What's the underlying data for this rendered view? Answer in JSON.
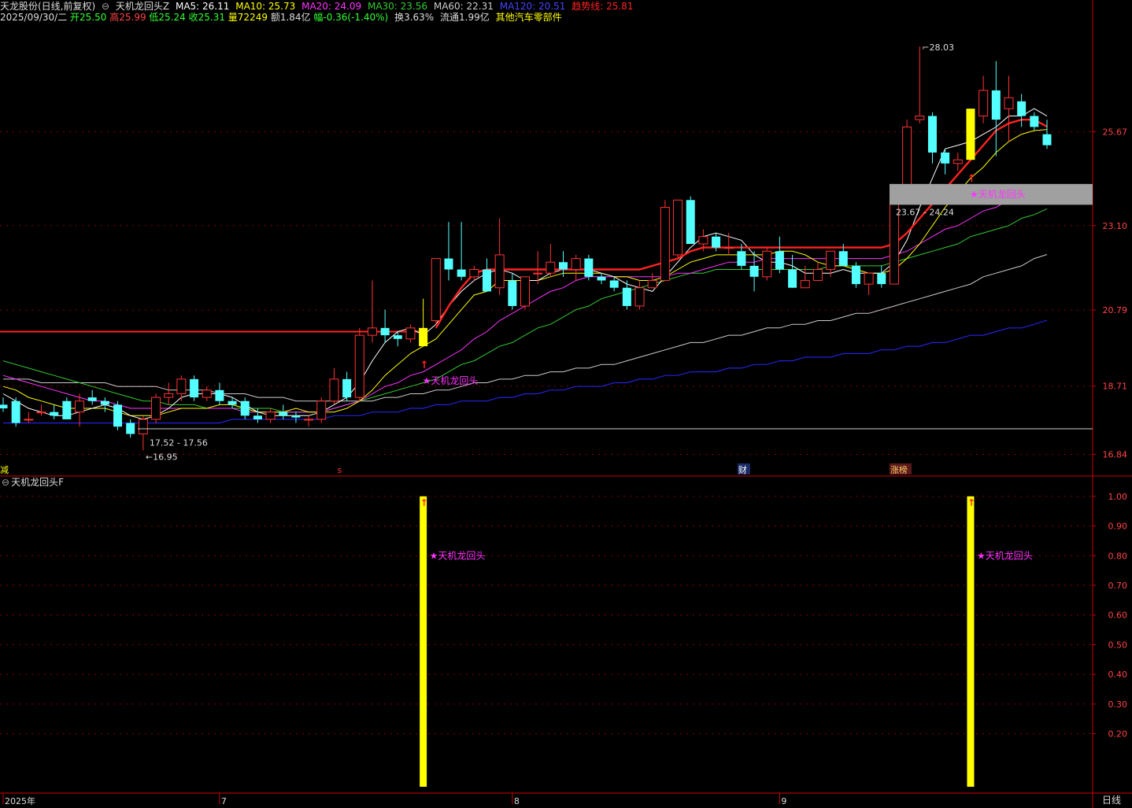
{
  "header": {
    "stock": "天龙股份(日线,前复权)",
    "indicator_name": "天机龙回头Z",
    "ma5": {
      "label": "MA5: 26.11",
      "color": "#ffffff"
    },
    "ma10": {
      "label": "MA10: 25.73",
      "color": "#ffff00"
    },
    "ma20": {
      "label": "MA20: 24.09",
      "color": "#ff33ff"
    },
    "ma30": {
      "label": "MA30: 23.56",
      "color": "#33cc33"
    },
    "ma60": {
      "label": "MA60: 22.31",
      "color": "#cccccc"
    },
    "ma120": {
      "label": "MA120: 20.51",
      "color": "#3333ff"
    },
    "trend": {
      "label": "趋势线: 25.81",
      "color": "#ff2222"
    }
  },
  "quote": {
    "date": "2025/09/30/二",
    "open": "开25.50",
    "high": "高25.99",
    "low": "低25.24",
    "close": "收25.31",
    "volume": "量72249",
    "amount": "额1.84亿",
    "change": "幅-0.36(-1.40%)",
    "turnover": "换3.63%",
    "float": "流通1.99亿",
    "sector": "其他汽车零部件"
  },
  "sub_panel_title": "天机龙回头F",
  "period_tab": "日线",
  "colors": {
    "up": "#ff3333",
    "down": "#54ffff",
    "signal": "#ffff00",
    "grid": "#8b0000"
  },
  "chart_data": [
    {
      "type": "candlestick",
      "ylim": [
        16.4,
        28.8
      ],
      "y_ticks": [
        "25.67",
        "23.10",
        "20.79",
        "18.71",
        "16.84"
      ],
      "y_tick_values": [
        25.67,
        23.1,
        20.79,
        18.71,
        16.84
      ],
      "x_labels": [
        "2025年",
        "7",
        "8",
        "9"
      ],
      "x_label_index": [
        0,
        17,
        40,
        61
      ],
      "annotations": {
        "high_label": "28.03",
        "low_label": "16.95",
        "range_low": "17.52 - 17.56",
        "range_high": "23.67 - 24.24",
        "signal_text": "★天机龙回头",
        "event_s": "s",
        "event_cai": "财",
        "event_zhangbang": "涨榜",
        "event_left": "减"
      },
      "ohlc": [
        [
          18.2,
          18.4,
          18.0,
          18.1
        ],
        [
          18.3,
          18.4,
          17.6,
          17.7
        ],
        [
          17.8,
          18.0,
          17.7,
          17.8
        ],
        [
          18.0,
          18.2,
          17.9,
          18.0
        ],
        [
          18.0,
          18.2,
          17.8,
          17.9
        ],
        [
          18.3,
          18.4,
          17.8,
          17.8
        ],
        [
          18.0,
          18.5,
          17.6,
          18.3
        ],
        [
          18.4,
          18.6,
          18.2,
          18.3
        ],
        [
          18.3,
          18.4,
          18.0,
          18.2
        ],
        [
          18.2,
          18.3,
          17.5,
          17.6
        ],
        [
          17.7,
          17.8,
          17.3,
          17.4
        ],
        [
          17.4,
          17.9,
          16.95,
          17.8
        ],
        [
          17.8,
          18.5,
          17.7,
          18.4
        ],
        [
          18.4,
          18.8,
          18.2,
          18.5
        ],
        [
          18.5,
          19.0,
          18.3,
          18.9
        ],
        [
          18.9,
          19.0,
          18.3,
          18.4
        ],
        [
          18.4,
          18.7,
          18.3,
          18.6
        ],
        [
          18.6,
          18.8,
          18.2,
          18.3
        ],
        [
          18.3,
          18.4,
          18.1,
          18.2
        ],
        [
          18.3,
          18.4,
          17.8,
          17.9
        ],
        [
          17.9,
          18.1,
          17.7,
          17.8
        ],
        [
          17.8,
          18.1,
          17.7,
          18.0
        ],
        [
          18.0,
          18.2,
          17.8,
          17.9
        ],
        [
          17.9,
          18.0,
          17.7,
          17.85
        ],
        [
          17.8,
          17.9,
          17.6,
          17.8
        ],
        [
          17.8,
          18.4,
          17.7,
          18.3
        ],
        [
          18.3,
          19.2,
          18.2,
          18.9
        ],
        [
          18.9,
          19.1,
          18.3,
          18.4
        ],
        [
          18.4,
          20.3,
          18.3,
          20.1
        ],
        [
          20.1,
          21.6,
          19.9,
          20.3
        ],
        [
          20.3,
          20.8,
          19.9,
          20.1
        ],
        [
          20.1,
          20.2,
          19.8,
          20.0
        ],
        [
          20.0,
          20.4,
          19.9,
          20.3
        ],
        [
          20.3,
          21.1,
          19.8,
          19.8
        ],
        [
          20.5,
          22.2,
          20.4,
          22.2
        ],
        [
          22.2,
          23.2,
          21.6,
          21.9
        ],
        [
          21.9,
          23.2,
          21.6,
          21.7
        ],
        [
          21.7,
          22.0,
          21.6,
          21.9
        ],
        [
          21.9,
          22.2,
          21.3,
          21.3
        ],
        [
          21.4,
          23.3,
          21.2,
          22.3
        ],
        [
          21.6,
          21.8,
          20.8,
          20.9
        ],
        [
          20.9,
          21.7,
          20.8,
          21.7
        ],
        [
          21.8,
          22.4,
          21.5,
          21.8
        ],
        [
          21.8,
          22.6,
          21.7,
          22.1
        ],
        [
          22.1,
          22.4,
          21.7,
          21.9
        ],
        [
          21.9,
          22.3,
          21.6,
          22.2
        ],
        [
          22.2,
          22.3,
          21.6,
          21.7
        ],
        [
          21.7,
          21.8,
          21.5,
          21.6
        ],
        [
          21.6,
          21.7,
          21.3,
          21.4
        ],
        [
          21.4,
          21.6,
          20.8,
          20.9
        ],
        [
          20.9,
          21.6,
          20.8,
          21.4
        ],
        [
          21.4,
          21.8,
          21.4,
          21.6
        ],
        [
          21.6,
          23.8,
          21.6,
          23.6
        ],
        [
          22.3,
          23.8,
          22.2,
          23.8
        ],
        [
          23.8,
          23.9,
          22.6,
          22.6
        ],
        [
          22.6,
          23.0,
          22.4,
          22.8
        ],
        [
          22.8,
          22.9,
          22.4,
          22.5
        ],
        [
          22.5,
          22.9,
          22.3,
          22.5
        ],
        [
          22.4,
          22.6,
          21.9,
          22.0
        ],
        [
          22.0,
          22.4,
          21.3,
          21.7
        ],
        [
          21.7,
          22.5,
          21.6,
          22.4
        ],
        [
          22.4,
          22.8,
          21.8,
          21.9
        ],
        [
          21.9,
          22.3,
          21.4,
          21.4
        ],
        [
          21.4,
          22.0,
          21.5,
          21.6
        ],
        [
          21.6,
          22.1,
          21.6,
          21.9
        ],
        [
          21.9,
          22.4,
          21.7,
          22.4
        ],
        [
          22.4,
          22.6,
          22.0,
          22.0
        ],
        [
          22.0,
          22.1,
          21.4,
          21.5
        ],
        [
          21.5,
          21.8,
          21.2,
          21.8
        ],
        [
          21.8,
          22.0,
          21.4,
          21.5
        ],
        [
          21.5,
          23.8,
          21.5,
          23.8
        ],
        [
          23.8,
          26.0,
          23.7,
          25.8
        ],
        [
          26.0,
          28.0,
          25.9,
          26.1
        ],
        [
          26.1,
          26.2,
          24.8,
          25.1
        ],
        [
          25.1,
          25.2,
          24.5,
          24.8
        ],
        [
          24.8,
          25.1,
          24.6,
          24.9
        ],
        [
          24.9,
          26.3,
          24.9,
          26.3
        ],
        [
          26.1,
          27.2,
          25.9,
          26.8
        ],
        [
          26.8,
          27.6,
          25.0,
          26.0
        ],
        [
          26.3,
          27.2,
          25.4,
          26.6
        ],
        [
          26.5,
          26.7,
          25.8,
          26.1
        ],
        [
          26.1,
          26.2,
          25.7,
          25.8
        ],
        [
          25.6,
          26.0,
          25.2,
          25.3
        ]
      ],
      "ma5": [
        18.5,
        18.3,
        18.1,
        18.0,
        17.9,
        17.9,
        18.0,
        18.1,
        18.2,
        18.1,
        17.9,
        17.8,
        17.9,
        18.1,
        18.4,
        18.5,
        18.5,
        18.5,
        18.4,
        18.2,
        18.0,
        17.9,
        17.9,
        17.9,
        17.9,
        18.0,
        18.2,
        18.4,
        18.8,
        19.4,
        19.9,
        20.2,
        20.3,
        20.1,
        20.4,
        20.9,
        21.3,
        21.6,
        21.8,
        21.9,
        21.8,
        21.6,
        21.6,
        21.8,
        21.9,
        21.9,
        21.9,
        21.8,
        21.7,
        21.5,
        21.4,
        21.3,
        21.7,
        22.1,
        22.5,
        22.8,
        22.9,
        22.8,
        22.7,
        22.3,
        22.1,
        22.1,
        22.0,
        21.8,
        21.8,
        21.8,
        21.9,
        21.8,
        21.8,
        21.8,
        22.1,
        22.7,
        23.6,
        24.4,
        25.2,
        25.3,
        25.4,
        25.6,
        25.8,
        26.1,
        26.1,
        26.3,
        26.1
      ],
      "ma10": [
        18.7,
        18.6,
        18.4,
        18.3,
        18.2,
        18.1,
        18.1,
        18.1,
        18.1,
        18.0,
        17.9,
        17.9,
        17.9,
        18.0,
        18.1,
        18.1,
        18.1,
        18.2,
        18.2,
        18.1,
        18.0,
        18.0,
        18.0,
        18.1,
        18.0,
        18.0,
        18.0,
        18.1,
        18.3,
        18.6,
        19.0,
        19.3,
        19.6,
        19.8,
        20.0,
        20.4,
        20.8,
        21.2,
        21.3,
        21.6,
        21.6,
        21.6,
        21.6,
        21.7,
        21.8,
        21.8,
        21.8,
        21.8,
        21.7,
        21.7,
        21.6,
        21.6,
        21.7,
        21.9,
        22.1,
        22.2,
        22.3,
        22.3,
        22.3,
        22.3,
        22.3,
        22.4,
        22.4,
        22.3,
        22.1,
        22.0,
        22.0,
        21.9,
        21.8,
        21.8,
        21.9,
        22.2,
        22.6,
        23.1,
        23.6,
        24.0,
        24.4,
        24.7,
        25.1,
        25.4,
        25.6,
        25.7,
        25.73
      ],
      "ma20": [
        19.0,
        18.9,
        18.8,
        18.7,
        18.6,
        18.5,
        18.4,
        18.3,
        18.3,
        18.2,
        18.1,
        18.1,
        18.1,
        18.1,
        18.1,
        18.1,
        18.1,
        18.1,
        18.1,
        18.0,
        18.0,
        18.0,
        18.0,
        18.0,
        18.0,
        18.0,
        18.1,
        18.2,
        18.3,
        18.5,
        18.7,
        18.8,
        19.0,
        19.1,
        19.3,
        19.5,
        19.7,
        20.0,
        20.2,
        20.5,
        20.7,
        20.9,
        21.1,
        21.3,
        21.4,
        21.6,
        21.7,
        21.7,
        21.7,
        21.7,
        21.7,
        21.7,
        21.7,
        21.8,
        21.8,
        21.9,
        22.0,
        22.1,
        22.1,
        22.1,
        22.2,
        22.2,
        22.2,
        22.2,
        22.2,
        22.2,
        22.2,
        22.2,
        22.2,
        22.2,
        22.3,
        22.4,
        22.6,
        22.8,
        23.0,
        23.1,
        23.3,
        23.5,
        23.6,
        23.8,
        23.9,
        24.0,
        24.09
      ],
      "ma30": [
        19.4,
        19.3,
        19.2,
        19.1,
        19.0,
        18.9,
        18.8,
        18.7,
        18.6,
        18.5,
        18.4,
        18.3,
        18.3,
        18.2,
        18.2,
        18.2,
        18.1,
        18.1,
        18.1,
        18.1,
        18.1,
        18.1,
        18.0,
        18.0,
        18.0,
        18.0,
        18.1,
        18.2,
        18.3,
        18.4,
        18.5,
        18.6,
        18.7,
        18.8,
        18.9,
        19.1,
        19.3,
        19.4,
        19.6,
        19.8,
        19.9,
        20.1,
        20.3,
        20.4,
        20.6,
        20.8,
        20.9,
        21.1,
        21.2,
        21.3,
        21.4,
        21.5,
        21.6,
        21.7,
        21.8,
        21.8,
        21.9,
        21.9,
        21.9,
        21.9,
        21.9,
        21.9,
        21.9,
        21.9,
        21.9,
        22.0,
        22.0,
        22.0,
        22.0,
        22.0,
        22.1,
        22.2,
        22.3,
        22.4,
        22.5,
        22.6,
        22.8,
        22.9,
        23.0,
        23.1,
        23.3,
        23.4,
        23.56
      ],
      "ma60": [
        18.9,
        18.9,
        18.9,
        18.8,
        18.8,
        18.8,
        18.8,
        18.8,
        18.8,
        18.7,
        18.7,
        18.7,
        18.7,
        18.6,
        18.6,
        18.6,
        18.6,
        18.5,
        18.5,
        18.5,
        18.4,
        18.4,
        18.4,
        18.3,
        18.3,
        18.3,
        18.3,
        18.3,
        18.3,
        18.3,
        18.4,
        18.4,
        18.5,
        18.5,
        18.6,
        18.6,
        18.7,
        18.8,
        18.8,
        18.9,
        18.9,
        19.0,
        19.0,
        19.1,
        19.1,
        19.2,
        19.2,
        19.3,
        19.3,
        19.4,
        19.5,
        19.6,
        19.7,
        19.8,
        19.9,
        19.9,
        20.0,
        20.1,
        20.1,
        20.2,
        20.3,
        20.3,
        20.4,
        20.4,
        20.5,
        20.5,
        20.6,
        20.7,
        20.7,
        20.8,
        20.9,
        21.0,
        21.1,
        21.2,
        21.3,
        21.4,
        21.5,
        21.7,
        21.8,
        21.9,
        22.0,
        22.2,
        22.31
      ],
      "ma120": [
        17.7,
        17.7,
        17.7,
        17.7,
        17.7,
        17.7,
        17.7,
        17.7,
        17.7,
        17.7,
        17.7,
        17.7,
        17.7,
        17.7,
        17.7,
        17.7,
        17.7,
        17.7,
        17.8,
        17.8,
        17.8,
        17.8,
        17.8,
        17.8,
        17.8,
        17.8,
        17.9,
        17.9,
        17.9,
        18.0,
        18.0,
        18.0,
        18.1,
        18.1,
        18.2,
        18.2,
        18.3,
        18.3,
        18.3,
        18.4,
        18.4,
        18.5,
        18.5,
        18.6,
        18.6,
        18.7,
        18.7,
        18.7,
        18.8,
        18.8,
        18.9,
        18.9,
        19.0,
        19.0,
        19.1,
        19.1,
        19.1,
        19.2,
        19.2,
        19.3,
        19.3,
        19.4,
        19.4,
        19.5,
        19.5,
        19.5,
        19.6,
        19.6,
        19.6,
        19.7,
        19.7,
        19.8,
        19.8,
        19.9,
        19.9,
        20.0,
        20.1,
        20.1,
        20.2,
        20.3,
        20.3,
        20.4,
        20.51
      ],
      "trend": [
        null,
        null,
        null,
        null,
        null,
        null,
        null,
        null,
        null,
        null,
        null,
        null,
        null,
        null,
        null,
        null,
        null,
        null,
        null,
        null,
        null,
        null,
        null,
        null,
        null,
        null,
        null,
        null,
        null,
        null,
        null,
        null,
        null,
        null,
        20.3,
        20.9,
        21.4,
        21.8,
        21.9,
        21.9,
        21.9,
        21.9,
        21.9,
        21.9,
        21.9,
        21.9,
        21.9,
        21.9,
        21.9,
        21.9,
        21.9,
        22.0,
        22.1,
        22.2,
        22.4,
        22.5,
        22.5,
        22.5,
        22.5,
        22.5,
        22.5,
        22.5,
        22.5,
        22.5,
        22.5,
        22.5,
        22.5,
        22.5,
        22.5,
        22.5,
        22.6,
        22.9,
        23.3,
        23.7,
        24.1,
        24.5,
        24.9,
        25.3,
        25.7,
        25.9,
        26.0,
        26.0,
        25.81
      ],
      "trend_flat_early": 20.2,
      "signals": [
        33,
        76
      ]
    },
    {
      "type": "bar",
      "title": "天机龙回头F",
      "ylim": [
        0,
        1.05
      ],
      "y_ticks": [
        "1.00",
        "0.90",
        "0.80",
        "0.70",
        "0.60",
        "0.50",
        "0.40",
        "0.30",
        "0.20"
      ],
      "y_tick_values": [
        1.0,
        0.9,
        0.8,
        0.7,
        0.6,
        0.5,
        0.4,
        0.3,
        0.2
      ],
      "bars": [
        {
          "index": 33,
          "value": 1.0
        },
        {
          "index": 76,
          "value": 1.0
        }
      ],
      "label": "★天机龙回头",
      "label_value": 0.8
    }
  ]
}
